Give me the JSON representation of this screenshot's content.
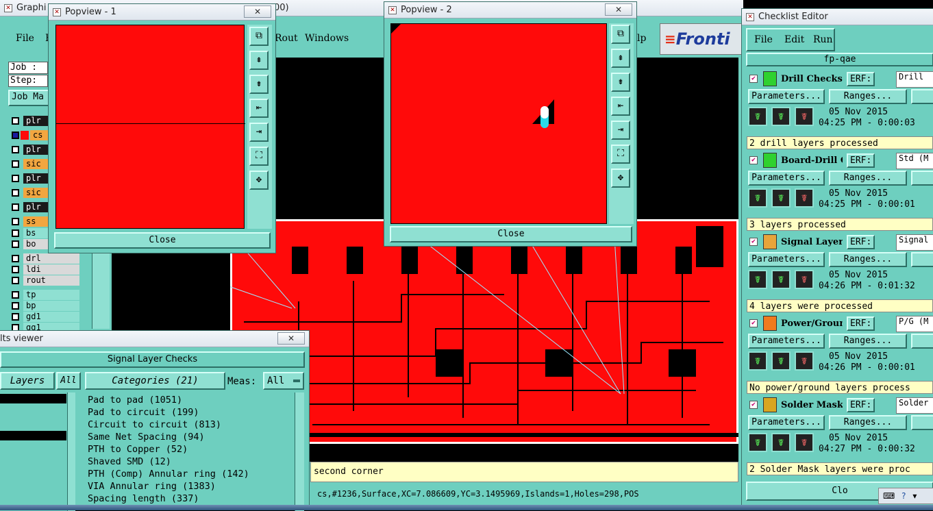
{
  "main_window": {
    "title": "Graphi",
    "title_tail": "00)",
    "menu": [
      "File",
      "E",
      "Rout",
      "Windows",
      "lp"
    ],
    "brand": "Fronti",
    "job_label": "Job :",
    "step_label": "Step: 4",
    "job_manager": "Job Ma",
    "prompt_text": "second corner",
    "info_text": "cs,#1236,Surface,XC=7.086609,YC=3.1495969,Islands=1,Holes=298,POS"
  },
  "layers": [
    {
      "name": "plr",
      "style": "dark"
    },
    {
      "name": "cs",
      "style": "orange",
      "active": true
    },
    {
      "name": "plr",
      "style": "dark"
    },
    {
      "name": "sic",
      "style": "orange"
    },
    {
      "name": "plr",
      "style": "dark"
    },
    {
      "name": "sic",
      "style": "orange"
    },
    {
      "name": "plr",
      "style": "dark"
    },
    {
      "name": "ss",
      "style": "orange"
    },
    {
      "name": "bs",
      "style": "teal2"
    },
    {
      "name": "bo",
      "style": "light"
    },
    {
      "name": "drl",
      "style": "light"
    },
    {
      "name": "ldi",
      "style": "light"
    },
    {
      "name": "rout",
      "style": "light"
    },
    {
      "name": "tp",
      "style": "teal2"
    },
    {
      "name": "bp",
      "style": "teal2"
    },
    {
      "name": "gd1",
      "style": "teal2"
    },
    {
      "name": "gg1",
      "style": "teal2"
    }
  ],
  "popview1": {
    "title": "Popview - 1",
    "close": "Close",
    "close_x": "✕"
  },
  "popview2": {
    "title": "Popview - 2",
    "close": "Close",
    "close_x": "✕"
  },
  "popview_tools": [
    "⧉",
    "⇞",
    "⇟",
    "⇤",
    "⇥",
    "⛶",
    "✥"
  ],
  "results_viewer": {
    "title": "lts viewer",
    "close_x": "✕",
    "header": "Signal Layer Checks",
    "tab_layers": "Layers",
    "tab_all": "All",
    "tab_categories": "Categories (21)",
    "meas_label": "Meas:",
    "meas_value": "All",
    "categories": [
      "Pad to pad (1051)",
      "Pad to circuit (199)",
      "Circuit to circuit (813)",
      "Same Net Spacing (94)",
      "PTH to Copper (52)",
      "Shaved SMD (12)",
      "PTH (Comp) Annular ring (142)",
      "VIA Annular ring (1383)",
      "Spacing length (337)"
    ]
  },
  "checklist": {
    "title": "Checklist Editor",
    "close_x": "✕",
    "menu": [
      "File",
      "Edit",
      "Run"
    ],
    "job_name": "fp-qae",
    "params_label": "Parameters...",
    "ranges_label": "Ranges...",
    "erf_label": "ERF:",
    "check_mark": "✔",
    "close_label": "Clo",
    "items": [
      {
        "name": "Drill Checks",
        "erf": "Drill",
        "date": "05 Nov 2015",
        "time": "04:25 PM - 0:00:03",
        "status": "2 drill layers processed",
        "icon_color": "#2fd12f"
      },
      {
        "name": "Board-Drill Che",
        "erf": "Std (M",
        "date": "05 Nov 2015",
        "time": "04:25 PM - 0:00:01",
        "status": "3 layers processed",
        "icon_color": "#2fd12f"
      },
      {
        "name": "Signal Layer Ch",
        "erf": "Signal",
        "date": "05 Nov 2015",
        "time": "04:26 PM - 0:01:32",
        "status": "4 layers were processed",
        "icon_color": "#e8a43a"
      },
      {
        "name": "Power/Ground C",
        "erf": "P/G (M",
        "date": "05 Nov 2015",
        "time": "04:26 PM - 0:00:01",
        "status": "No power/ground layers process",
        "icon_color": "#f07a1e"
      },
      {
        "name": "Solder Mask Che",
        "erf": "Solder",
        "date": "05 Nov 2015",
        "time": "04:27 PM - 0:00:32",
        "status": "2 Solder Mask layers were proc",
        "icon_color": "#d9a520"
      }
    ]
  },
  "colors": {
    "teal": "#6ecfbf",
    "board_red": "#ff0a0a",
    "status_yellow": "#ffffc4"
  }
}
